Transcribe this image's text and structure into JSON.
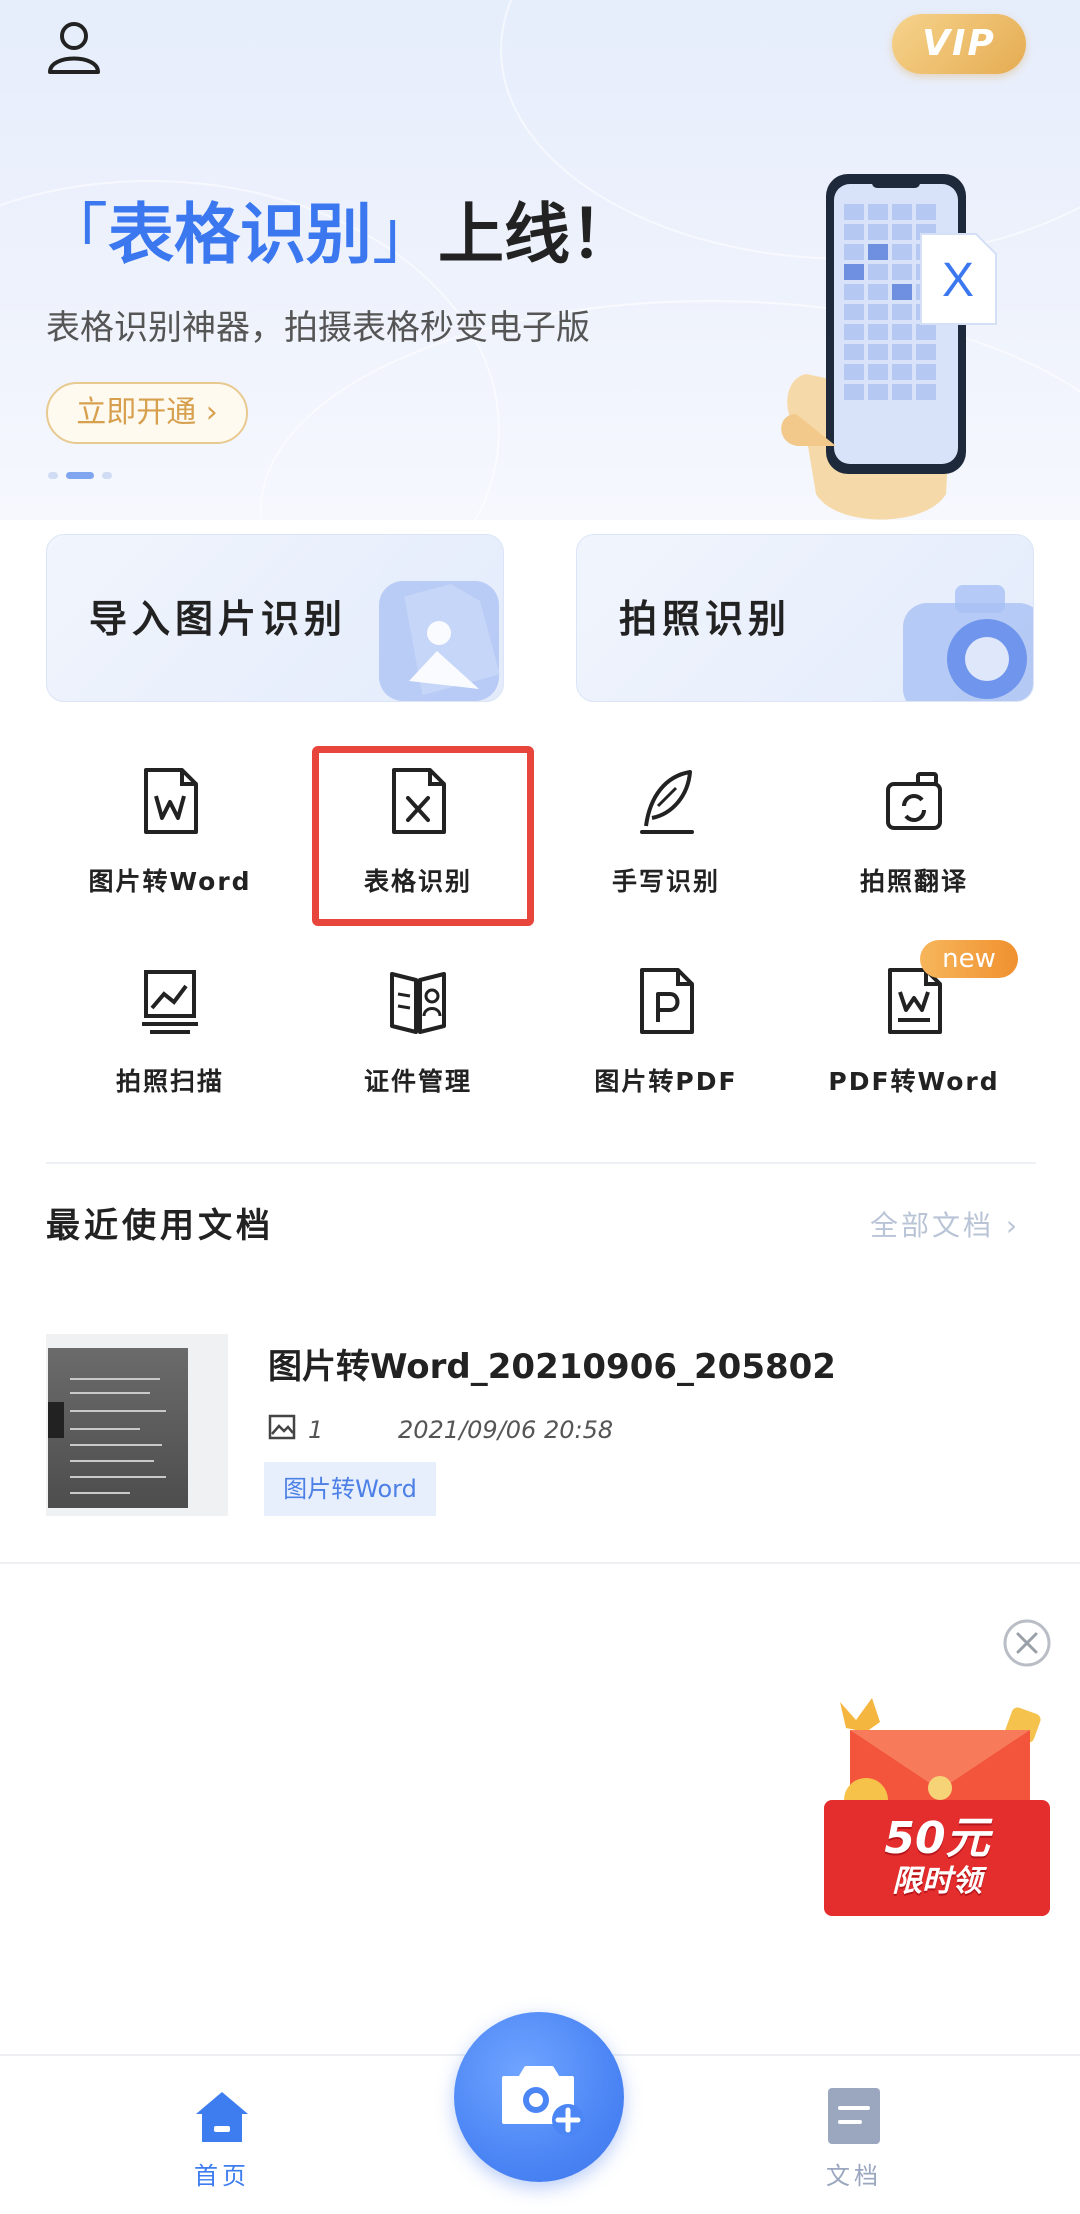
{
  "header": {
    "vip_label": "VIP"
  },
  "banner": {
    "title_open": "「",
    "title_highlight": "表格识别",
    "title_close": "」",
    "title_rest": "上线！",
    "subtitle": "表格识别神器，拍摄表格秒变电子版",
    "cta_label": "立即开通",
    "cta_arrow": "›",
    "art_badge": "X"
  },
  "actions": {
    "import_label": "导入图片识别",
    "camera_label": "拍照识别"
  },
  "tools": [
    {
      "label": "图片转Word",
      "icon": "word-doc-icon"
    },
    {
      "label": "表格识别",
      "icon": "excel-doc-icon"
    },
    {
      "label": "手写识别",
      "icon": "feather-pen-icon"
    },
    {
      "label": "拍照翻译",
      "icon": "camera-translate-icon"
    },
    {
      "label": "拍照扫描",
      "icon": "scan-image-icon"
    },
    {
      "label": "证件管理",
      "icon": "id-card-icon"
    },
    {
      "label": "图片转PDF",
      "icon": "pdf-doc-icon"
    },
    {
      "label": "PDF转Word",
      "icon": "pdf-word-icon"
    }
  ],
  "new_badge": "new",
  "recent": {
    "title": "最近使用文档",
    "view_all": "全部文档",
    "view_all_arrow": "›",
    "items": [
      {
        "title": "图片转Word_20210906_205802",
        "image_count": "1",
        "time": "2021/09/06 20:58",
        "tag": "图片转Word"
      }
    ]
  },
  "promo": {
    "amount": "50元",
    "caption": "限时领"
  },
  "tabbar": {
    "home_label": "首页",
    "docs_label": "文档"
  },
  "colors": {
    "accent": "#3b78f0",
    "highlight_box": "#e8453c",
    "vip_gold": "#e5ac52",
    "tag_bg": "#e7effd"
  }
}
